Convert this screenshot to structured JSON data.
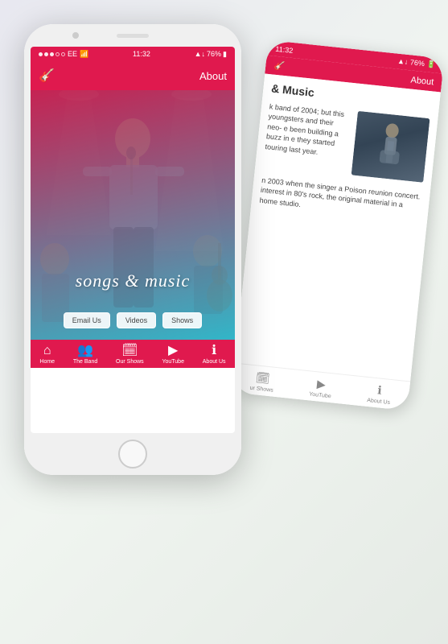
{
  "background": {
    "color": "#e8eae8"
  },
  "phone_back": {
    "status_bar": {
      "time": "11:32",
      "signal": "▲ ↓ 76%",
      "battery": "🔋"
    },
    "nav": {
      "title": "About",
      "guitar_icon": "🎸"
    },
    "content": {
      "heading": "& Music",
      "paragraphs": [
        "k band of 2004; but this youngsters and their neo- e been building a buzz in e they started touring last year.",
        "n 2003 when the singer a Poison reunion concert. interest in 80's rock, the original material in a home studio."
      ]
    },
    "bottom_nav": {
      "items": [
        {
          "label": "ur Shows",
          "icon": "🗓"
        },
        {
          "label": "YouTube",
          "icon": "▶"
        },
        {
          "label": "About Us",
          "icon": "ℹ"
        }
      ]
    }
  },
  "phone_front": {
    "status_bar": {
      "carrier": "EE",
      "wifi": "wifi",
      "time": "11:32",
      "signal_arrows": "▲↓",
      "battery_pct": "76%",
      "battery_icon": "🔋"
    },
    "nav": {
      "title": "About",
      "guitar_icon": "🎸"
    },
    "hero": {
      "title": "songs & music",
      "overlay_colors": [
        "#c0305a",
        "#40b8c8"
      ]
    },
    "action_buttons": [
      {
        "label": "Email Us",
        "id": "email-btn"
      },
      {
        "label": "Videos",
        "id": "videos-btn"
      },
      {
        "label": "Shows",
        "id": "shows-btn"
      }
    ],
    "bottom_nav": {
      "items": [
        {
          "label": "Home",
          "icon": "⌂",
          "active": true
        },
        {
          "label": "The Band",
          "icon": "👥",
          "active": false
        },
        {
          "label": "Our Shows",
          "icon": "🗓",
          "active": false
        },
        {
          "label": "YouTube",
          "icon": "▶",
          "active": false
        },
        {
          "label": "About Us",
          "icon": "ℹ",
          "active": false
        }
      ]
    }
  }
}
